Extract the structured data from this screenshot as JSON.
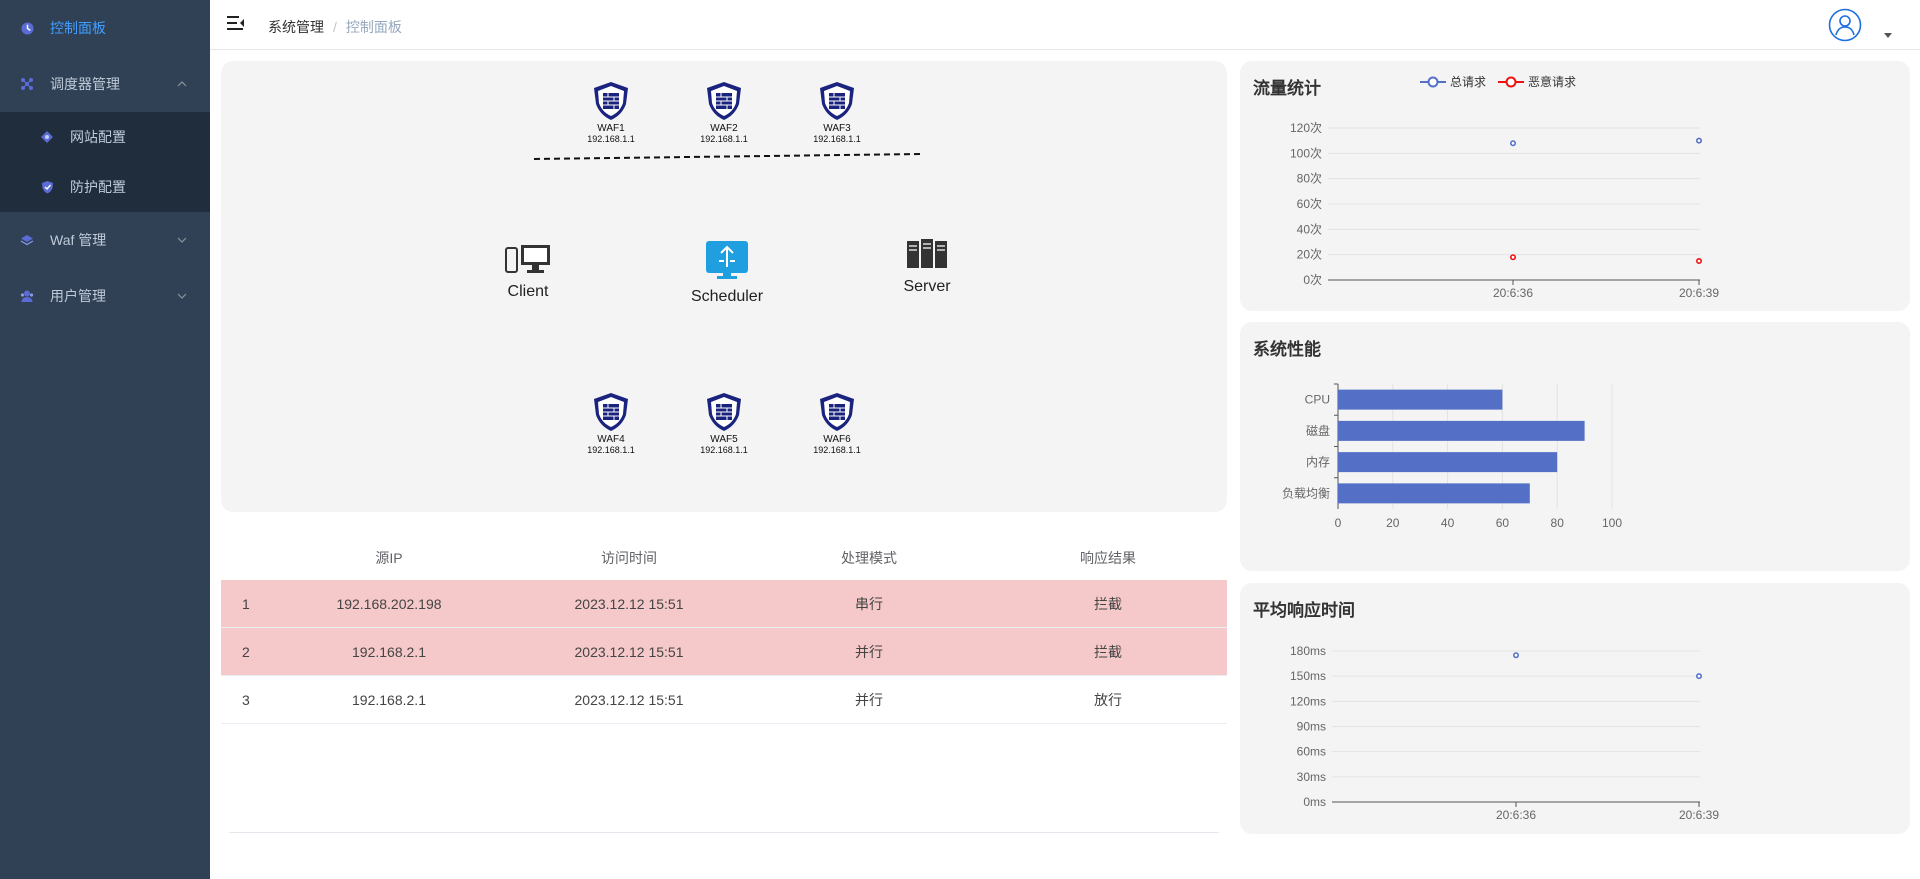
{
  "sidebar": {
    "items": [
      {
        "label": "控制面板",
        "icon": "dashboard-icon",
        "active": true
      },
      {
        "label": "调度器管理",
        "icon": "scheduler-icon",
        "expanded": true,
        "children": [
          {
            "label": "网站配置",
            "icon": "website-icon"
          },
          {
            "label": "防护配置",
            "icon": "shield-icon"
          }
        ]
      },
      {
        "label": "Waf 管理",
        "icon": "layers-icon"
      },
      {
        "label": "用户管理",
        "icon": "users-icon"
      }
    ]
  },
  "header": {
    "breadcrumb": [
      "系统管理",
      "控制面板"
    ],
    "separator": "/"
  },
  "topology": {
    "waf_top": [
      {
        "name": "WAF1",
        "ip": "192.168.1.1"
      },
      {
        "name": "WAF2",
        "ip": "192.168.1.1"
      },
      {
        "name": "WAF3",
        "ip": "192.168.1.1"
      }
    ],
    "waf_bottom": [
      {
        "name": "WAF4",
        "ip": "192.168.1.1"
      },
      {
        "name": "WAF5",
        "ip": "192.168.1.1"
      },
      {
        "name": "WAF6",
        "ip": "192.168.1.1"
      }
    ],
    "client_label": "Client",
    "scheduler_label": "Scheduler",
    "server_label": "Server"
  },
  "table": {
    "headers": [
      "源IP",
      "访问时间",
      "处理模式",
      "响应结果"
    ],
    "rows": [
      {
        "idx": "1",
        "ip": "192.168.202.198",
        "time": "2023.12.12 15:51",
        "mode": "串行",
        "result": "拦截",
        "blocked": true
      },
      {
        "idx": "2",
        "ip": "192.168.2.1",
        "time": "2023.12.12 15:51",
        "mode": "并行",
        "result": "拦截",
        "blocked": true
      },
      {
        "idx": "3",
        "ip": "192.168.2.1",
        "time": "2023.12.12 15:51",
        "mode": "并行",
        "result": "放行",
        "blocked": false
      }
    ]
  },
  "colors": {
    "blue_series": "#5470c6",
    "red_series": "#ee1111",
    "blocked_row": "#f5c8c9",
    "sidebar_bg": "#304156",
    "active_menu": "#409eff"
  },
  "chart_data": [
    {
      "type": "line",
      "title": "流量统计",
      "x": [
        "20:6:36",
        "20:6:39"
      ],
      "series": [
        {
          "name": "总请求",
          "values": [
            108,
            110
          ],
          "color": "#5470c6"
        },
        {
          "name": "恶意请求",
          "values": [
            18,
            15
          ],
          "color": "#ee1111"
        }
      ],
      "y_ticks": [
        "0次",
        "20次",
        "40次",
        "60次",
        "80次",
        "100次",
        "120次"
      ],
      "ylim": [
        0,
        120
      ],
      "legend": "top"
    },
    {
      "type": "bar",
      "orientation": "horizontal",
      "title": "系统性能",
      "categories": [
        "CPU",
        "磁盘",
        "内存",
        "负载均衡"
      ],
      "values": [
        60,
        90,
        80,
        70
      ],
      "x_ticks": [
        "0",
        "20",
        "40",
        "60",
        "80",
        "100"
      ],
      "xlim": [
        0,
        100
      ],
      "color": "#5470c6"
    },
    {
      "type": "line",
      "title": "平均响应时间",
      "x": [
        "20:6:36",
        "20:6:39"
      ],
      "series": [
        {
          "values": [
            175,
            150
          ],
          "color": "#5470c6"
        }
      ],
      "y_ticks": [
        "0ms",
        "30ms",
        "60ms",
        "90ms",
        "120ms",
        "150ms",
        "180ms"
      ],
      "ylim": [
        0,
        180
      ]
    }
  ]
}
